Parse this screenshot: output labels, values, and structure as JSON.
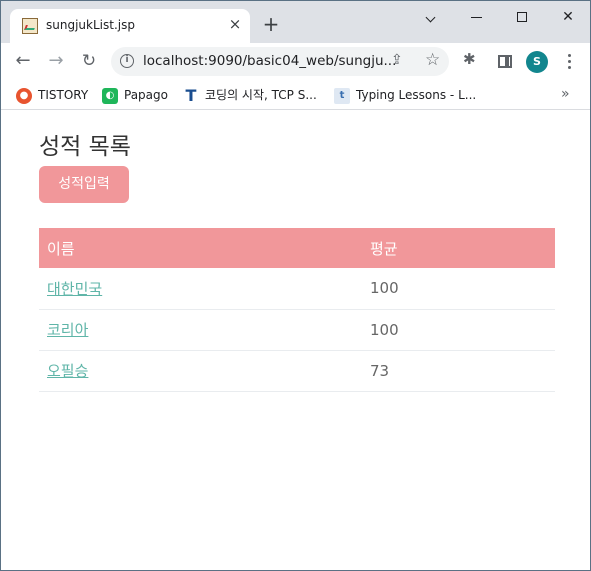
{
  "browser": {
    "tab_title": "sungjukList.jsp",
    "tab_close": "×",
    "new_tab": "+",
    "url": "localhost:9090/basic04_web/sungju...",
    "profile_initial": "S",
    "bookmarks": [
      {
        "label": "TISTORY",
        "icon": "tistory-icon"
      },
      {
        "label": "Papago",
        "icon": "papago-icon"
      },
      {
        "label": "코딩의 시작, TCP S...",
        "icon": "tcp-school-icon"
      },
      {
        "label": "Typing Lessons - L...",
        "icon": "typing-lessons-icon"
      }
    ],
    "bookmarks_more": "»"
  },
  "page": {
    "title": "성적 목록",
    "add_button": "성적입력",
    "table": {
      "headers": [
        "이름",
        "평균"
      ],
      "rows": [
        {
          "name": "대한민국",
          "avg": "100"
        },
        {
          "name": "코리아",
          "avg": "100"
        },
        {
          "name": "오필승",
          "avg": "73"
        }
      ]
    }
  },
  "colors": {
    "accent": "#f1979a",
    "link": "#5fb5a8",
    "profile": "#12868e"
  }
}
